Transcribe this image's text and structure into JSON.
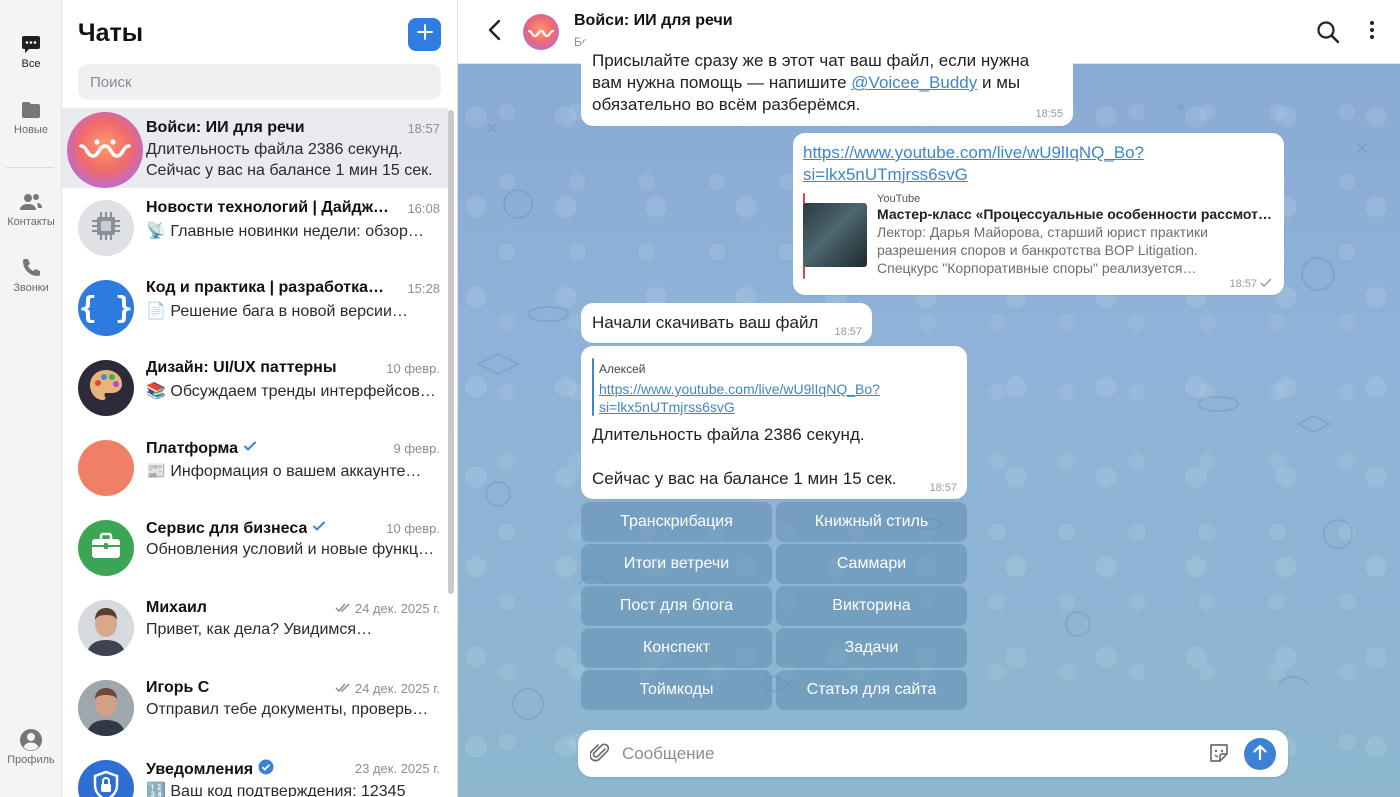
{
  "rail": {
    "items": [
      {
        "label": "Все",
        "icon": "chat-bubble-icon"
      },
      {
        "label": "Новые",
        "icon": "folder-icon"
      },
      {
        "label": "Контакты",
        "icon": "contacts-icon"
      },
      {
        "label": "Звонки",
        "icon": "phone-icon"
      },
      {
        "label": "Профиль",
        "icon": "profile-icon"
      }
    ]
  },
  "chats": {
    "title": "Чаты",
    "search_placeholder": "Поиск",
    "items": [
      {
        "name": "Войси: ИИ для речи",
        "time": "18:57",
        "line1": "Длительность файла 2386 секунд.",
        "line2": "Сейчас у вас на балансе 1 мин 15 сек."
      },
      {
        "name": "Новости технологий | Дайджест…",
        "time": "16:08",
        "line1": "📡 Главные новинки недели: обзор…"
      },
      {
        "name": "Код и практика | разработка…",
        "time": "15:28",
        "line1": "📄 Решение бага в новой версии…"
      },
      {
        "name": "Дизайн: UI/UX паттерны",
        "time": "10 февр.",
        "line1": "📚 Обсуждаем тренды интерфейсов…"
      },
      {
        "name": "Платформа",
        "time": "9 февр.",
        "line1": "📰 Информация о вашем аккаунте…"
      },
      {
        "name": "Сервис для бизнеса",
        "time": "10 февр.",
        "line1": "Обновления условий и новые функции…"
      },
      {
        "name": "Михаил",
        "time": "24 дек. 2025 г.",
        "line1": "Привет, как дела? Увидимся…"
      },
      {
        "name": "Игорь С",
        "time": "24 дек. 2025 г.",
        "line1": "Отправил тебе документы, проверь…"
      },
      {
        "name": "Уведомления",
        "time": "23 дек. 2025 г.",
        "line1": "🔢 Ваш код подтверждения: 12345"
      }
    ]
  },
  "header": {
    "name": "Войси: ИИ для речи",
    "status": "Бот"
  },
  "messages": {
    "m1": {
      "line0": "Присылайте сразу же в этот чат ваш файл, если нужна",
      "line1_pre": "вам нужна помощь — напишите ",
      "mention": "@Voicee_Buddy",
      "line1_post": " и мы",
      "line2": "обязательно во всём разберёмся.",
      "time": "18:55"
    },
    "m2": {
      "link1": "https://www.youtube.com/live/wU9lIqNQ_Bo?",
      "link2": "si=lkx5nUTmjrss6svG",
      "preview_site": "YouTube",
      "preview_title": "Мастер-класс «Процессуальные особенности рассмотре…",
      "preview_l1": "Лектор: Дарья Майорова, старший юрист практики",
      "preview_l2": "разрешения споров и банкротства BOP Litigation.",
      "preview_l3": "Спецкурс \"Корпоративные споры\" реализуется…",
      "time": "18:57"
    },
    "m3": {
      "text": "Начали скачивать ваш файл",
      "time": "18:57"
    },
    "m4": {
      "reply_author": "Алексей",
      "reply_link1": "https://www.youtube.com/live/wU9lIqNQ_Bo?",
      "reply_link2": "si=lkx5nUTmjrss6svG",
      "line1": "Длительность файла 2386 секунд.",
      "line2": "Сейчас у вас на балансе 1 мин 15 сек.",
      "time": "18:57"
    }
  },
  "keyboard": [
    [
      "Транскрибация",
      "Книжный стиль"
    ],
    [
      "Итоги ветречи",
      "Саммари"
    ],
    [
      "Пост для блога",
      "Викторина"
    ],
    [
      "Конспект",
      "Задачи"
    ],
    [
      "Тоймкоды",
      "Статья для сайта"
    ]
  ],
  "composer": {
    "placeholder": "Сообщение"
  },
  "colors": {
    "accent": "#2f7de1",
    "link": "#3f86c9",
    "verified": "#3b82d6"
  }
}
